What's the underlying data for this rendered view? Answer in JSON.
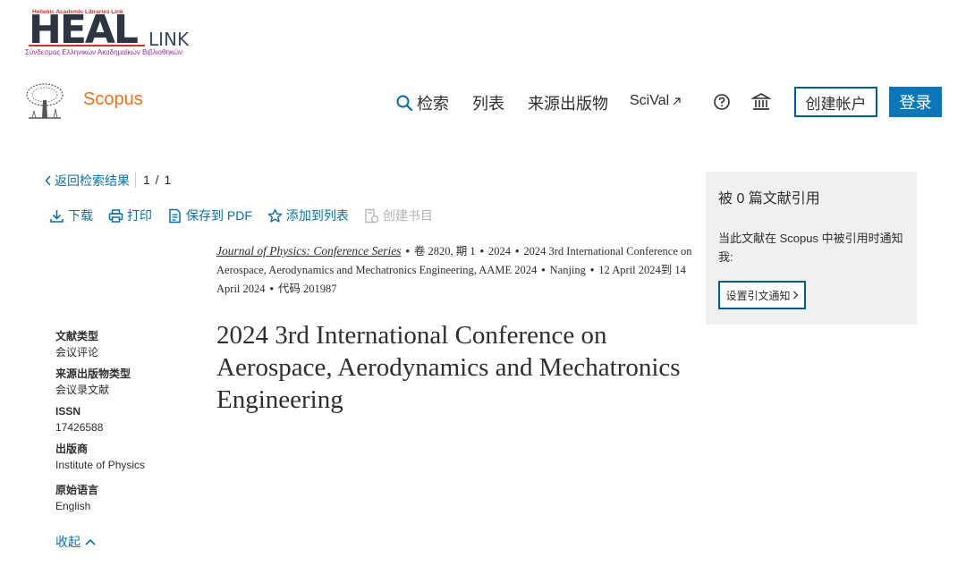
{
  "heal": {
    "top_text": "Hellenic Academic Libraries Link",
    "word": "HEAL",
    "link": "LINK",
    "subtitle": "Σύνδεσμος Ελληνικών Ακαδημαϊκών Βιβλιοθηκών"
  },
  "header": {
    "brand": "Scopus",
    "nav": {
      "search": "检索",
      "lists": "列表",
      "sources": "来源出版物",
      "scival": "SciVal"
    },
    "create_account": "创建帐户",
    "login": "登录"
  },
  "back": {
    "label": "返回检索结果",
    "pager": "1 / 1"
  },
  "actions": {
    "download": "下载",
    "print": "打印",
    "save_pdf": "保存到 PDF",
    "add_list": "添加到列表",
    "create_bib": "创建书目"
  },
  "source": {
    "journal": "Journal of Physics: Conference Series",
    "volume": "卷 2820, 期 1",
    "year": "2024",
    "conference": "2024 3rd International Conference on Aerospace, Aerodynamics and Mechatronics Engineering, AAME 2024",
    "location": "Nanjing",
    "dates": "12 April 2024到 14 April 2024",
    "code": "代码 201987"
  },
  "title": "2024 3rd International Conference on Aerospace, Aerodynamics and Mechatronics Engineering",
  "meta": {
    "doc_type_label": "文献类型",
    "doc_type": "会议评论",
    "source_type_label": "来源出版物类型",
    "source_type": "会议录文献",
    "issn_label": "ISSN",
    "issn": "17426588",
    "publisher_label": "出版商",
    "publisher": "Institute of Physics",
    "language_label": "原始语言",
    "language": "English",
    "collapse": "收起"
  },
  "panel": {
    "title": "被 0 篇文献引用",
    "text": "当此文献在 Scopus 中被引用时通知我:",
    "button": "设置引文通知"
  },
  "colors": {
    "scopus_orange": "#e9711c",
    "link_blue": "#0b6fa4",
    "login_blue": "#0b76b8",
    "panel_gray": "#f0f0f0"
  }
}
